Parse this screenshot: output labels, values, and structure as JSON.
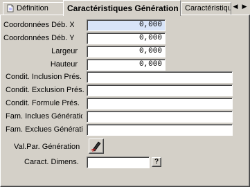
{
  "tabs": [
    {
      "label": "Définition",
      "active": false
    },
    {
      "label": "Caractéristiques Génération",
      "active": true
    },
    {
      "label": "Caractéristiqu",
      "active": false
    }
  ],
  "scroll": {
    "left": "◀",
    "right": "▶"
  },
  "fields": {
    "coord_x": {
      "label": "Coordonnées Déb. X",
      "value": "0,000"
    },
    "coord_y": {
      "label": "Coordonnées Déb. Y",
      "value": "0,000"
    },
    "largeur": {
      "label": "Largeur",
      "value": "0,000"
    },
    "hauteur": {
      "label": "Hauteur",
      "value": "0,000"
    },
    "cond_inclusion": {
      "label": "Condit. Inclusion Prés.",
      "value": ""
    },
    "cond_exclusion": {
      "label": "Condit. Exclusion Prés.",
      "value": ""
    },
    "cond_formule": {
      "label": "Condit. Formule Prés.",
      "value": ""
    },
    "fam_incluses": {
      "label": "Fam. Inclues Génération",
      "value": ""
    },
    "fam_exclues": {
      "label": "Fam. Exclues Génération",
      "value": ""
    },
    "val_par": {
      "label": "Val.Par. Génération",
      "icon": "edit-pen-icon"
    },
    "caract_dimens": {
      "label": "Caract. Dimens.",
      "value": "",
      "help": "?"
    }
  },
  "colors": {
    "window_bg": "#d4d0c8",
    "field_bg": "#ffffff",
    "focused_field_bg": "#d8e4f8"
  }
}
